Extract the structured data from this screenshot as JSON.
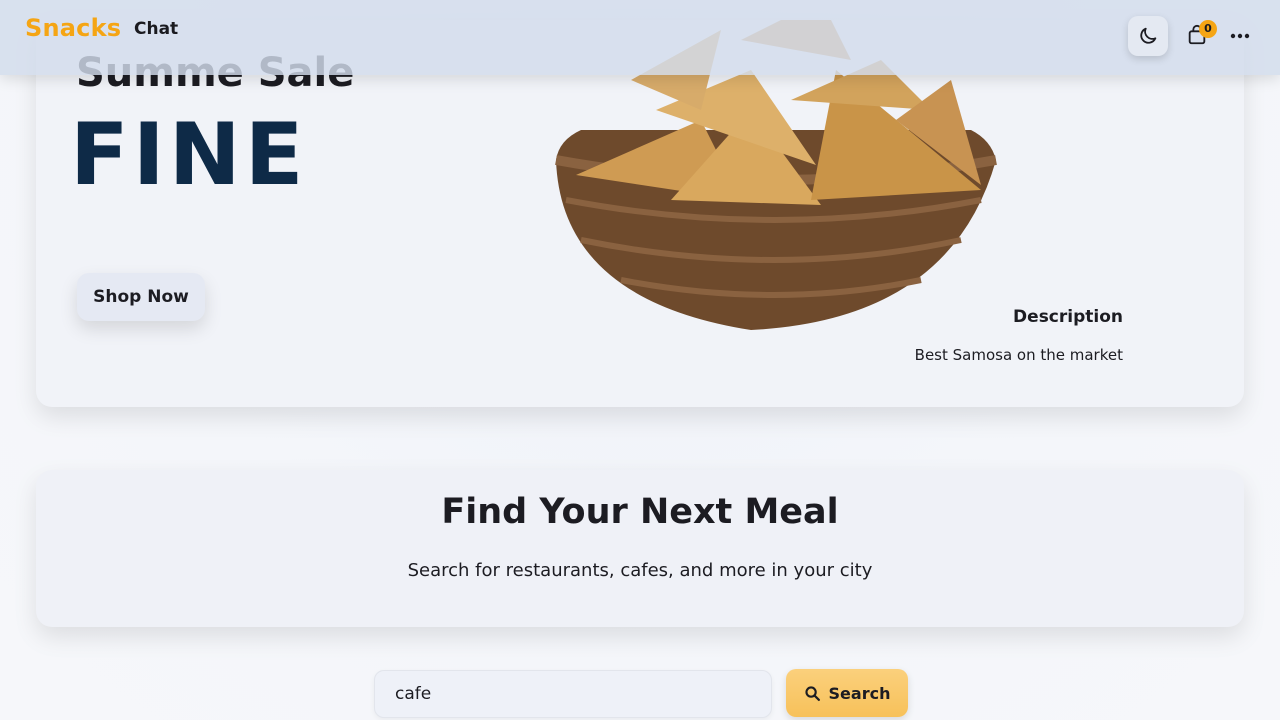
{
  "navbar": {
    "brand": "Snacks",
    "chat_label": "Chat",
    "cart_count": "0",
    "theme_icon": "moon-icon",
    "cart_icon": "shopping-bag-icon",
    "more_icon": "more-dots-icon"
  },
  "hero": {
    "subtitle": "Summe Sale",
    "title": "FINE",
    "shop_button": "Shop Now",
    "description_label": "Description",
    "description_text": "Best Samosa on the market",
    "image_icon": "samosa-basket-image"
  },
  "find": {
    "title": "Find Your Next Meal",
    "subtitle": "Search for restaurants, cafes, and more in your city"
  },
  "search": {
    "value": "cafe",
    "button_label": "Search",
    "button_icon": "search-icon"
  },
  "colors": {
    "brand": "#f5a514",
    "hero_title": "#0e2a47",
    "search_button": "#f7c15a"
  }
}
